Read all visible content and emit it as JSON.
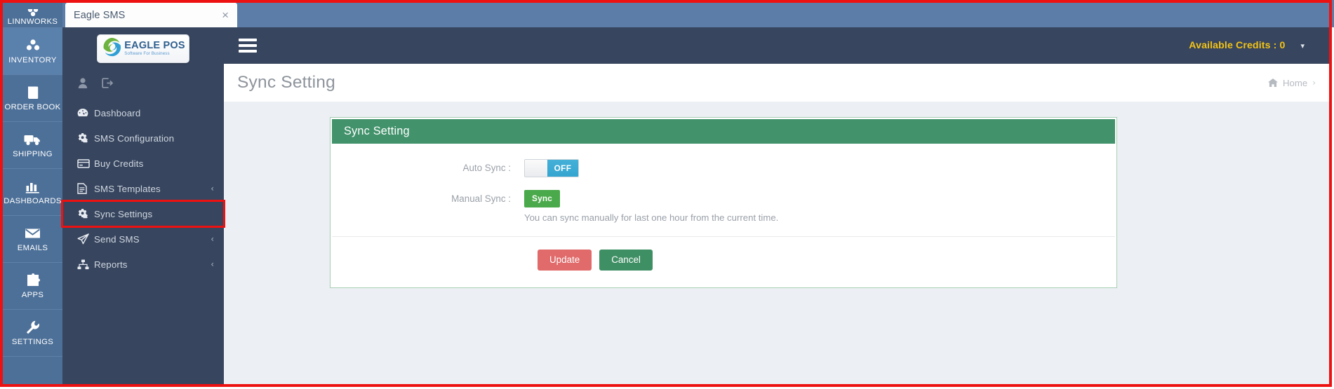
{
  "browser": {
    "tab_title": "Eagle SMS",
    "close_icon": "close-icon",
    "close_glyph": "×"
  },
  "linnworks_rail": {
    "items": [
      {
        "label": "LINNWORKS",
        "icon": "linnworks-logo-icon",
        "active": false
      },
      {
        "label": "INVENTORY",
        "icon": "boxes-icon",
        "active": true
      },
      {
        "label": "ORDER BOOK",
        "icon": "book-icon",
        "active": false
      },
      {
        "label": "SHIPPING",
        "icon": "truck-icon",
        "active": false
      },
      {
        "label": "DASHBOARDS",
        "icon": "bar-chart-icon",
        "active": false
      },
      {
        "label": "EMAILS",
        "icon": "envelope-icon",
        "active": false
      },
      {
        "label": "APPS",
        "icon": "puzzle-piece-icon",
        "active": false
      },
      {
        "label": "SETTINGS",
        "icon": "wrench-icon",
        "active": false
      }
    ]
  },
  "sidebar": {
    "logo": {
      "main_text": "EAGLE POS",
      "tagline": "Software For Business",
      "mark_icon": "eagle-swirl-icon",
      "mark_color_green": "#6cb33f",
      "mark_color_blue": "#2f9fd4"
    },
    "user_row": {
      "profile_icon": "user-icon",
      "logout_icon": "logout-icon"
    },
    "nav_items": [
      {
        "label": "Dashboard",
        "icon": "dashboard-icon",
        "caret": "",
        "highlighted": false
      },
      {
        "label": "SMS Configuration",
        "icon": "gears-icon",
        "caret": "",
        "highlighted": false
      },
      {
        "label": "Buy Credits",
        "icon": "credit-card-icon",
        "caret": "",
        "highlighted": false
      },
      {
        "label": "SMS Templates",
        "icon": "file-text-icon",
        "caret": "‹",
        "highlighted": false
      },
      {
        "label": "Sync Settings",
        "icon": "gears-icon",
        "caret": "",
        "highlighted": true
      },
      {
        "label": "Send SMS",
        "icon": "paper-plane-icon",
        "caret": "‹",
        "highlighted": false
      },
      {
        "label": "Reports",
        "icon": "sitemap-icon",
        "caret": "‹",
        "highlighted": false
      }
    ]
  },
  "topbar": {
    "menu_toggle_icon": "hamburger-icon",
    "credits_label": "Available Credits : 0",
    "credits_caret": "▾",
    "credits_color": "#f2c317"
  },
  "page": {
    "title": "Sync Setting",
    "breadcrumb": {
      "home_icon": "home-icon",
      "home_label": "Home",
      "separator": "›"
    }
  },
  "panel": {
    "title": "Sync Setting",
    "header_color": "#42936c",
    "rows": [
      {
        "label": "Auto Sync :",
        "control": "toggle",
        "toggle_state": "OFF",
        "toggle_on_color": "#34a5d0"
      },
      {
        "label": "Manual Sync :",
        "control": "button",
        "button_label": "Sync",
        "button_color": "#4aa94a",
        "help_text": "You can sync manually for last one hour from the current time."
      }
    ],
    "footer": {
      "update_label": "Update",
      "update_color": "#e16a6a",
      "cancel_label": "Cancel",
      "cancel_color": "#3f8f64"
    }
  }
}
